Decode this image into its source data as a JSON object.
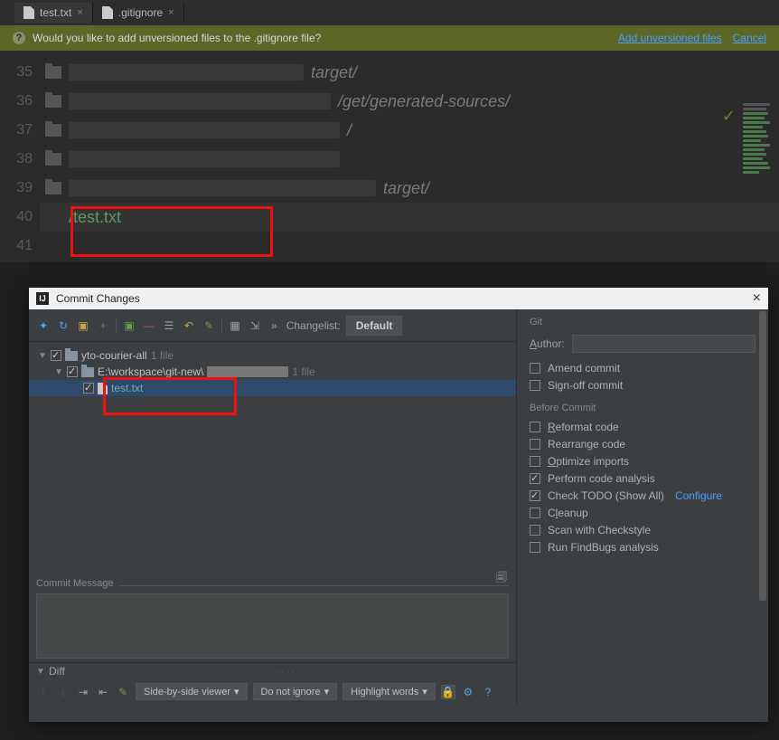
{
  "tabs": [
    {
      "label": "test.txt",
      "active": true
    },
    {
      "label": ".gitignore",
      "active": false
    }
  ],
  "banner": {
    "message": "Would you like to add unversioned files to the .gitignore file?",
    "link_add": "Add unversioned files",
    "link_cancel": "Cancel"
  },
  "editor": {
    "lines": [
      {
        "n": "35",
        "tail": "target/"
      },
      {
        "n": "36",
        "tail": "/get/generated-sources/"
      },
      {
        "n": "37",
        "tail": "/"
      },
      {
        "n": "38",
        "tail": ""
      },
      {
        "n": "39",
        "tail": "target/"
      },
      {
        "n": "40",
        "text": "/test.txt"
      },
      {
        "n": "41",
        "text": ""
      }
    ]
  },
  "dialog": {
    "title": "Commit Changes",
    "changelist_label": "Changelist:",
    "changelist_value": "Default",
    "tree": {
      "root": {
        "name": "yto-courier-all",
        "count": "1 file"
      },
      "path": {
        "name": "E:\\workspace\\git-new\\",
        "count": "1 file"
      },
      "file": {
        "name": "test.txt"
      }
    },
    "commit_message_label": "Commit Message",
    "diff_label": "Diff",
    "diff_toolbar": {
      "viewer": "Side-by-side viewer",
      "ignore": "Do not ignore",
      "highlight": "Highlight words"
    },
    "options": {
      "git_label": "Git",
      "author_label": "Author:",
      "amend": "Amend commit",
      "signoff": "Sign-off commit",
      "before_label": "Before Commit",
      "reformat": "Reformat code",
      "rearrange": "Rearrange code",
      "optimize": "Optimize imports",
      "analysis": "Perform code analysis",
      "todo": "Check TODO (Show All)",
      "configure": "Configure",
      "cleanup": "Cleanup",
      "checkstyle": "Scan with Checkstyle",
      "findbugs": "Run FindBugs analysis"
    }
  }
}
